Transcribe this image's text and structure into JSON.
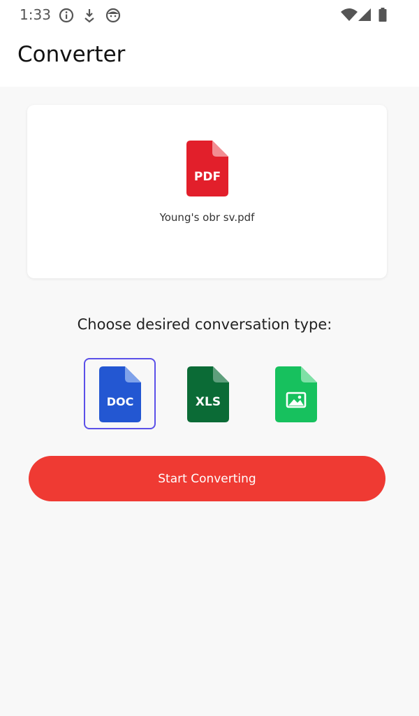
{
  "status_bar": {
    "time": "1:33",
    "icons": [
      "info-icon",
      "download-status-icon",
      "face-icon",
      "wifi-icon",
      "cell-signal-icon",
      "battery-icon"
    ]
  },
  "app_bar": {
    "title": "Converter"
  },
  "file_card": {
    "file_icon_label": "PDF",
    "file_name": "Young's obr sv.pdf",
    "file_icon_color": "#e21f2b"
  },
  "conversion": {
    "prompt": "Choose desired conversation type:",
    "options": [
      {
        "label": "DOC",
        "color": "#2357d2",
        "selected": true
      },
      {
        "label": "XLS",
        "color": "#0b6b36",
        "selected": false
      },
      {
        "label": "",
        "icon": "image-icon",
        "color": "#17c15e",
        "selected": false
      }
    ],
    "selected_border_color": "#5b50e8"
  },
  "actions": {
    "start_label": "Start Converting",
    "start_color": "#ef3a33"
  }
}
